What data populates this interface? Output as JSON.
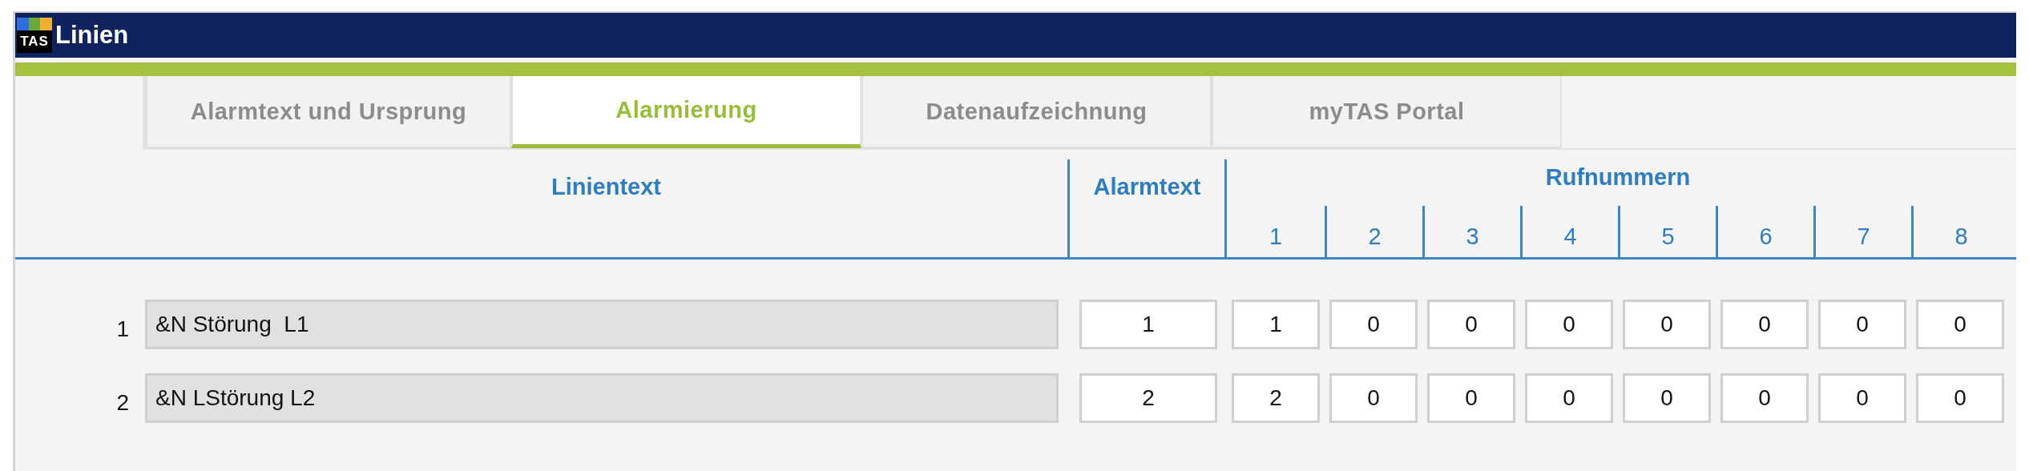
{
  "window": {
    "logo": "TAS",
    "title": "Linien"
  },
  "tabs": [
    {
      "label": "Alarmtext und Ursprung",
      "selected": false
    },
    {
      "label": "Alarmierung",
      "selected": true
    },
    {
      "label": "Datenaufzeichnung",
      "selected": false
    },
    {
      "label": "myTAS Portal",
      "selected": false
    }
  ],
  "table": {
    "columns": {
      "line_text": "Linientext",
      "alarm_text": "Alarmtext",
      "phone_numbers": "Rufnummern",
      "phone_slots": [
        "1",
        "2",
        "3",
        "4",
        "5",
        "6",
        "7",
        "8"
      ]
    },
    "rows": [
      {
        "number": "1",
        "line_text": "&N Störung  L1",
        "alarm_text": "1",
        "phone_numbers": [
          "1",
          "0",
          "0",
          "0",
          "0",
          "0",
          "0",
          "0"
        ]
      },
      {
        "number": "2",
        "line_text": "&N LStörung L2",
        "alarm_text": "2",
        "phone_numbers": [
          "2",
          "0",
          "0",
          "0",
          "0",
          "0",
          "0",
          "0"
        ]
      }
    ]
  }
}
